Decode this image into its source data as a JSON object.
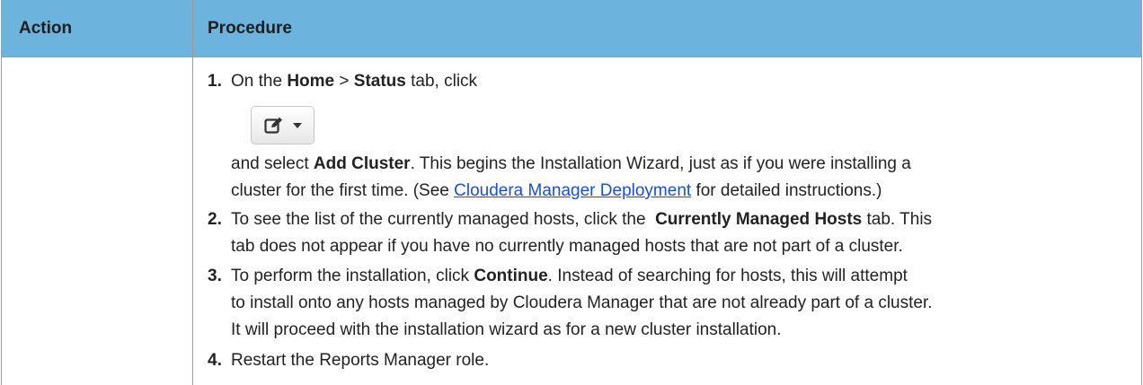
{
  "table": {
    "headers": {
      "action": "Action",
      "procedure": "Procedure"
    },
    "steps": [
      {
        "number": "1.",
        "line1": {
          "t1": "On the ",
          "b1": "Home",
          "t2": " > ",
          "b2": "Status",
          "t3": " tab, click"
        },
        "button_icon": "edit-icon",
        "line2": {
          "t1": "and select ",
          "b1": "Add Cluster",
          "t2": ". This begins the Installation Wizard, just as if you were installing a"
        },
        "line3": {
          "t1": "cluster for the first time. (See ",
          "link": "Cloudera Manager Deployment",
          "t2": " for detailed instructions.)"
        }
      },
      {
        "number": "2.",
        "line1": {
          "t1": "To see the list of the currently managed hosts, click the  ",
          "b1": "Currently Managed Hosts",
          "t2": " tab. This"
        },
        "line2": "tab does not appear if you have no currently managed hosts that are not part of a cluster."
      },
      {
        "number": "3.",
        "line1": {
          "t1": "To perform the installation, click ",
          "b1": "Continue",
          "t2": ". Instead of searching for hosts, this will attempt"
        },
        "line2": "to install onto any hosts managed by Cloudera Manager that are not already part of a cluster.",
        "line3": "It will proceed with the installation wizard as for a new cluster installation."
      },
      {
        "number": "4.",
        "line1": "Restart the Reports Manager role."
      }
    ]
  },
  "colors": {
    "header_bg": "#6cb4de",
    "border": "#9b9b9b",
    "link": "#1a4ed6"
  }
}
